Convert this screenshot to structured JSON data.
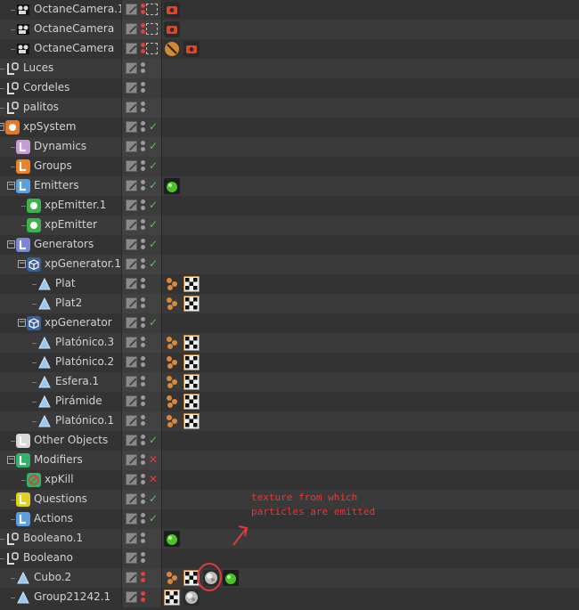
{
  "annotation": {
    "text_line1": "texture from which",
    "text_line2": "particles are emitted"
  },
  "rows": [
    {
      "name": "OctaneCamera.1",
      "icon": "camera-icon",
      "flag": "camera",
      "tags": [
        "camera-tag"
      ]
    },
    {
      "name": "OctaneCamera",
      "icon": "camera-icon",
      "flag": "camera",
      "tags": [
        "camera-tag"
      ]
    },
    {
      "name": "OctaneCamera",
      "icon": "camera-icon",
      "flag": "camera",
      "tags": [
        "target-tag",
        "camera-tag"
      ]
    },
    {
      "name": "Luces",
      "icon": "null-icon",
      "flag": "none",
      "tags": []
    },
    {
      "name": "Cordeles",
      "icon": "null-icon",
      "flag": "none",
      "tags": []
    },
    {
      "name": "palitos",
      "icon": "null-icon",
      "flag": "none",
      "tags": []
    },
    {
      "name": "xpSystem",
      "icon": "xpsystem-icon",
      "flag": "check",
      "tags": []
    },
    {
      "name": "Dynamics",
      "icon": "dynamics-icon",
      "flag": "check",
      "tags": []
    },
    {
      "name": "Groups",
      "icon": "groups-icon",
      "flag": "check",
      "tags": []
    },
    {
      "name": "Emitters",
      "icon": "emitters-icon",
      "flag": "check",
      "tags": [
        "green-sphere-tag"
      ]
    },
    {
      "name": "xpEmitter.1",
      "icon": "emitter-icon",
      "flag": "check",
      "tags": []
    },
    {
      "name": "xpEmitter",
      "icon": "emitter-icon",
      "flag": "check",
      "tags": []
    },
    {
      "name": "Generators",
      "icon": "generators-icon",
      "flag": "check",
      "tags": []
    },
    {
      "name": "xpGenerator.1",
      "icon": "generator-icon",
      "flag": "check",
      "tags": []
    },
    {
      "name": "Plat",
      "icon": "polygon-icon",
      "flag": "none",
      "tags": [
        "phong-tag",
        "material-tag"
      ]
    },
    {
      "name": "Plat2",
      "icon": "polygon-icon",
      "flag": "none",
      "tags": [
        "phong-tag",
        "material-tag"
      ]
    },
    {
      "name": "xpGenerator",
      "icon": "generator-icon",
      "flag": "check",
      "tags": []
    },
    {
      "name": "Platónico.3",
      "icon": "polygon-icon",
      "flag": "none",
      "tags": [
        "phong-tag",
        "material-tag"
      ]
    },
    {
      "name": "Platónico.2",
      "icon": "polygon-icon",
      "flag": "none",
      "tags": [
        "phong-tag",
        "material-tag"
      ]
    },
    {
      "name": "Esfera.1",
      "icon": "polygon-icon",
      "flag": "none",
      "tags": [
        "phong-tag",
        "material-tag"
      ]
    },
    {
      "name": "Pirámide",
      "icon": "polygon-icon",
      "flag": "none",
      "tags": [
        "phong-tag",
        "material-tag"
      ]
    },
    {
      "name": "Platónico.1",
      "icon": "polygon-icon",
      "flag": "none",
      "tags": [
        "phong-tag",
        "material-tag"
      ]
    },
    {
      "name": "Other Objects",
      "icon": "other-objects-icon",
      "flag": "check",
      "tags": []
    },
    {
      "name": "Modifiers",
      "icon": "modifiers-icon",
      "flag": "cross",
      "tags": []
    },
    {
      "name": "xpKill",
      "icon": "kill-icon",
      "flag": "cross",
      "tags": []
    },
    {
      "name": "Questions",
      "icon": "questions-icon",
      "flag": "check",
      "tags": []
    },
    {
      "name": "Actions",
      "icon": "actions-icon",
      "flag": "check",
      "tags": []
    },
    {
      "name": "Booleano.1",
      "icon": "null-icon",
      "flag": "none",
      "tags": [
        "green-sphere-tag"
      ]
    },
    {
      "name": "Booleano",
      "icon": "null-icon",
      "flag": "none",
      "tags": []
    },
    {
      "name": "Cubo.2",
      "icon": "polygon-icon",
      "flag": "red",
      "tags": [
        "phong-tag",
        "material-tag",
        "texture-tag",
        "green-sphere-tag"
      ]
    },
    {
      "name": "Group21242.1",
      "icon": "polygon-icon",
      "flag": "red",
      "tags": [
        "material-tag",
        "texture-tag"
      ]
    }
  ]
}
